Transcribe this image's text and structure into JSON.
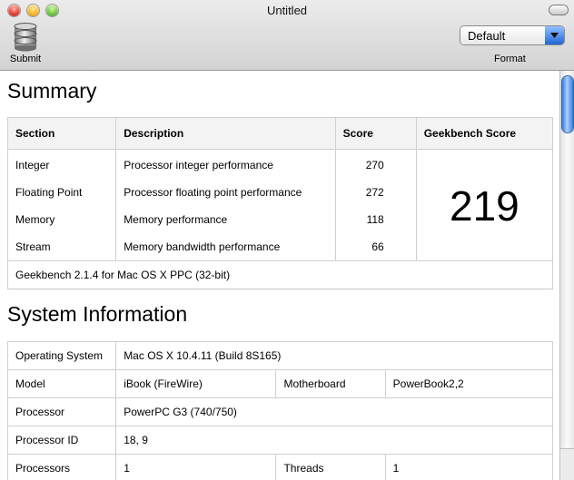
{
  "window": {
    "title": "Untitled"
  },
  "toolbar": {
    "submit_label": "Submit",
    "format_value": "Default",
    "format_label": "Format"
  },
  "summary": {
    "heading": "Summary",
    "headers": {
      "section": "Section",
      "description": "Description",
      "score": "Score",
      "geekbench": "Geekbench Score"
    },
    "rows": [
      {
        "section": "Integer",
        "description": "Processor integer performance",
        "score": "270"
      },
      {
        "section": "Floating Point",
        "description": "Processor floating point performance",
        "score": "272"
      },
      {
        "section": "Memory",
        "description": "Memory performance",
        "score": "118"
      },
      {
        "section": "Stream",
        "description": "Memory bandwidth performance",
        "score": "66"
      }
    ],
    "geekbench_score": "219",
    "footer": "Geekbench 2.1.4 for Mac OS X PPC (32-bit)"
  },
  "system": {
    "heading": "System Information",
    "os_label": "Operating System",
    "os_value": "Mac OS X 10.4.11 (Build 8S165)",
    "model_label": "Model",
    "model_value": "iBook (FireWire)",
    "motherboard_label": "Motherboard",
    "motherboard_value": "PowerBook2,2",
    "processor_label": "Processor",
    "processor_value": "PowerPC G3 (740/750)",
    "processor_id_label": "Processor ID",
    "processor_id_value": "18, 9",
    "processors_label": "Processors",
    "processors_value": "1",
    "threads_label": "Threads",
    "threads_value": "1"
  }
}
